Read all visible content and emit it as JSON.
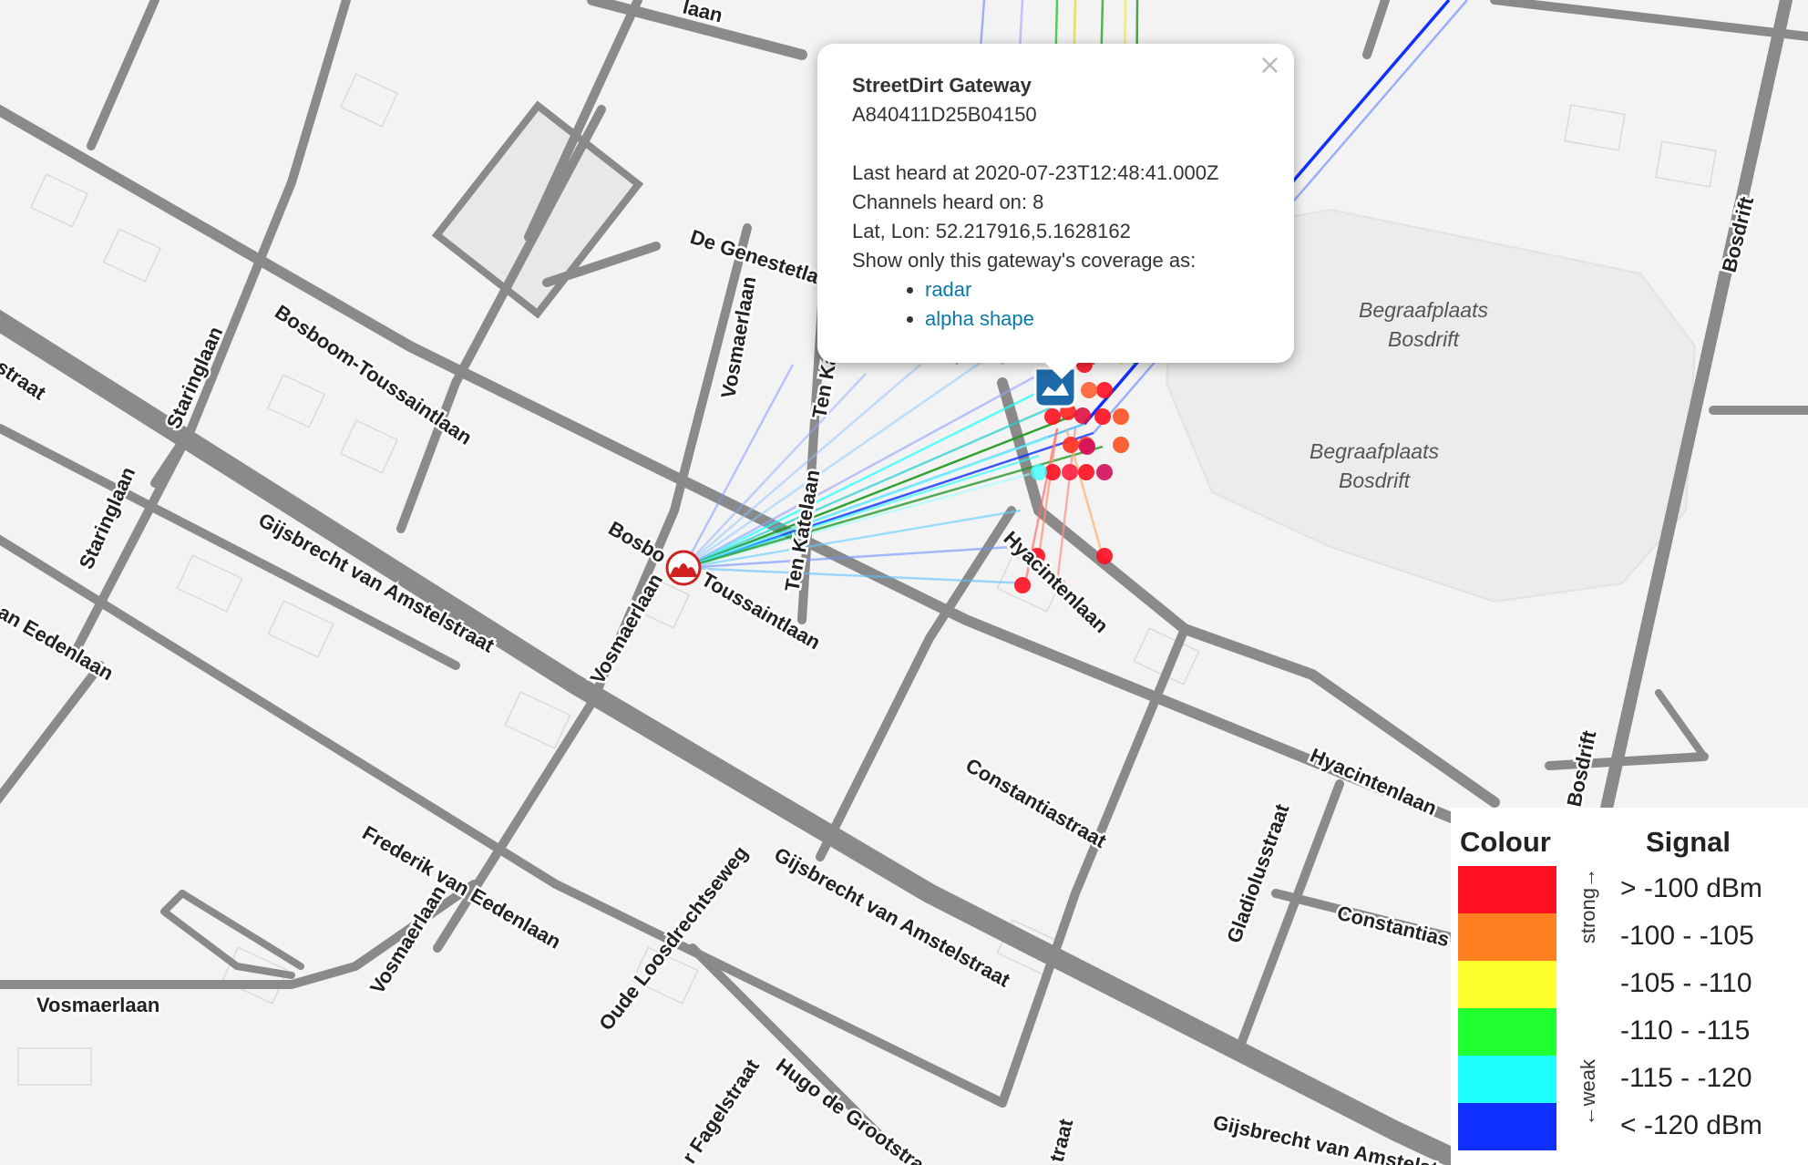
{
  "streets": {
    "gijsbrecht_1": "Gijsbrecht van Amstelstraat",
    "gijsbrecht_2": "Gijsbrecht van Amstelstraat",
    "gijsbrecht_3": "Gijsbrecht van Amstelstraat",
    "bosboom_1": "Bosboom-Toussaintlaan",
    "bosboom_2a": "Bosbo",
    "bosboom_2b": "Toussaintlaan",
    "staringlaan_1": "Staringlaan",
    "staringlaan_2": "Staringlaan",
    "de_genestet": "De Genestetla",
    "vosmaerlaan_1": "Vosmaerlaan",
    "vosmaerlaan_2": "Vosmaerlaan",
    "vosmaerlaan_3": "Vosmaerlaan",
    "vosmaerlaan_4": "Vosmaerlaan",
    "ten_kate_1": "Ten Ka",
    "ten_kate_2": "Ten Katelaan",
    "hyacintenlaan_1": "Hyacintenlaan",
    "hyacintenlaan_2": "Hyacintenlaan",
    "constantiastraat_1": "Constantiastraat",
    "constantiastraat_2": "Constantias",
    "gladiolusstraat": "Gladiolusstraat",
    "bosdrift_1": "Bosdrift",
    "bosdrift_2": "Bosdrift",
    "frederik": "Frederik van Eedenlaan",
    "frederik_left": "an Eedenlaan",
    "oude_loosdrechtseweg": "Oude Loosdrechtseweg",
    "hugo": "Hugo de Grootstra",
    "fagelstraat": "r Fagelstraat",
    "straat_left": "straat",
    "laan_top": "laan",
    "straat_bottom": "traat"
  },
  "areas": {
    "cemetery_1": [
      "Begraafplaats",
      "Bosdrift"
    ],
    "cemetery_2": [
      "Begraafplaats",
      "Bosdrift"
    ]
  },
  "popup": {
    "close": "×",
    "title": "StreetDirt Gateway",
    "eui": "A840411D25B04150",
    "last_heard": "Last heard at 2020-07-23T12:48:41.000Z",
    "channels": "Channels heard on: 8",
    "latlon": "Lat, Lon: 52.217916,5.1628162",
    "show_only": "Show only this gateway's coverage as:",
    "links": [
      "radar",
      "alpha shape"
    ]
  },
  "legend": {
    "colour_header": "Colour",
    "signal_header": "Signal",
    "strong_label": "strong→",
    "weak_label": "←weak",
    "rows": [
      {
        "color": "#ff1020",
        "label": "> -100 dBm"
      },
      {
        "color": "#ff8020",
        "label": "-100 - -105"
      },
      {
        "color": "#ffff30",
        "label": "-105 - -110"
      },
      {
        "color": "#20ff30",
        "label": "-110 - -115"
      },
      {
        "color": "#20ffff",
        "label": "-115 - -120"
      },
      {
        "color": "#1030ff",
        "label": "< -120 dBm"
      }
    ]
  },
  "colors": {
    "road": "#8a8a8a",
    "background": "#f3f3f3",
    "gateway_marker": "#d02020",
    "selected_gateway": "#1e6aa8"
  }
}
